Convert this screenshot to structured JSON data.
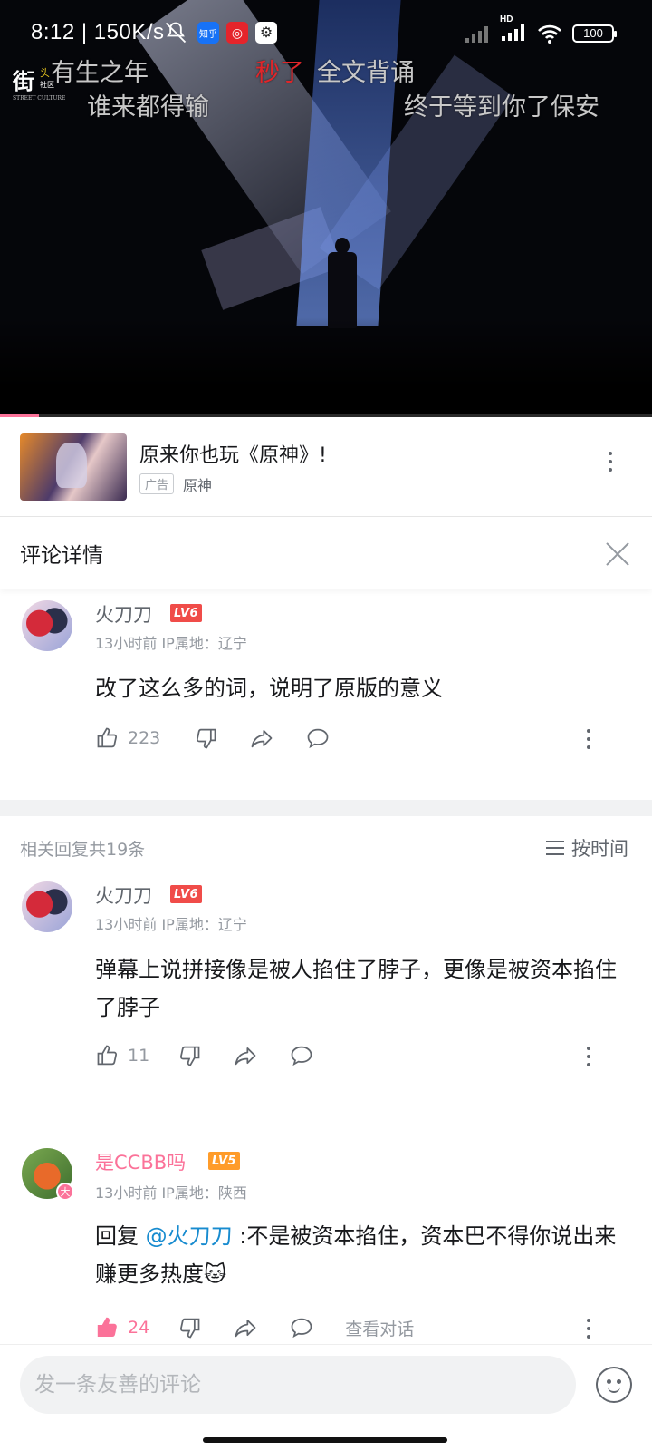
{
  "status": {
    "time": "8:12",
    "speed": "150K/s",
    "app1": "知乎",
    "signal_label": "HD",
    "battery": "100"
  },
  "video": {
    "logo_big": "街",
    "logo_small": "头",
    "logo_small2": "社区",
    "logo_tiny": "STREET CULTURE",
    "progress": 0.06,
    "danmaku": [
      {
        "text": "有生之年",
        "color": "#c8c8c8"
      },
      {
        "text": "秒了",
        "color": "#e0262a"
      },
      {
        "text": "全文背诵",
        "color": "#c8c8c8"
      },
      {
        "text": "谁来都得输",
        "color": "#c8c8c8"
      },
      {
        "text": "终于等到你了保安",
        "color": "#c8c8c8"
      }
    ]
  },
  "ad": {
    "title": "原来你也玩《原神》!",
    "badge": "广告",
    "source": "原神"
  },
  "panel": {
    "title": "评论详情"
  },
  "main_comment": {
    "user": "火刀刀",
    "level": "LV6",
    "time_ip": "13小时前  IP属地：辽宁",
    "text": "改了这么多的词，说明了原版的意义",
    "likes": "223"
  },
  "related": {
    "count_label": "相关回复共19条",
    "sort_label": "按时间"
  },
  "replies": [
    {
      "user": "火刀刀",
      "level": "LV6",
      "time_ip": "13小时前  IP属地：辽宁",
      "text": "弹幕上说拼接像是被人掐住了脖子，更像是被资本掐住了脖子",
      "likes": "11"
    },
    {
      "user": "是CCBB吗",
      "level": "LV5",
      "badge": "大",
      "time_ip": "13小时前  IP属地：陕西",
      "prefix": "回复 ",
      "mention": "@火刀刀",
      "text": " :不是被资本掐住，资本巴不得你说出来赚更多热度",
      "emoji": "🐱",
      "likes": "24",
      "view_conversation": "查看对话"
    }
  ],
  "bottom": {
    "placeholder": "发一条友善的评论"
  },
  "colors": {
    "accent": "#fb7299",
    "mention": "#178bcf"
  }
}
